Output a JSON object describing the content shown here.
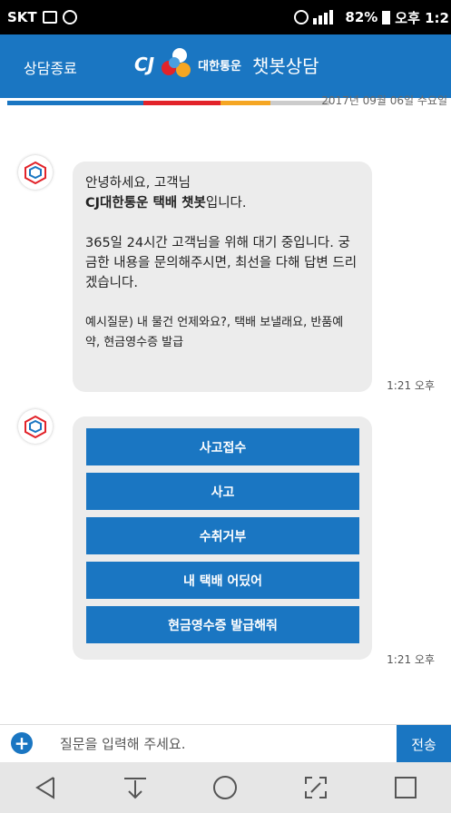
{
  "status_bar": {
    "carrier": "SKT",
    "clock_icon": "alarm-icon",
    "battery": "82%",
    "time": "오후 1:2"
  },
  "header": {
    "end_label": "상담종료",
    "logo_text": "CJ",
    "corp_name": "대한통운",
    "title": "챗봇상담",
    "colors": {
      "bar": "#1a76c2"
    }
  },
  "date": "2017년 09월 06일 수요일",
  "messages": [
    {
      "greeting": "안녕하세요, 고객님",
      "intro_bold": "CJ대한통운 택배 챗봇",
      "intro_rest": "입니다.",
      "para1": "365일 24시간 고객님을 위해 대기 중입니다. 궁금한 내용을 문의해주시면, 최선을 다해 답변 드리겠습니다.",
      "para2": "예시질문) 내 물건 언제와요?, 택배 보낼래요, 반품예약, 현금영수증 발급",
      "time": "1:21 오후"
    },
    {
      "buttons": [
        "사고접수",
        "사고",
        "수취거부",
        "내 택배 어딨어",
        "현금영수증 발급해줘"
      ],
      "time": "1:21 오후"
    }
  ],
  "input": {
    "placeholder": "질문을 입력해 주세요.",
    "send_label": "전송"
  },
  "nav": [
    "back-icon",
    "download-icon",
    "home-icon",
    "screen-expand-icon",
    "recent-apps-icon"
  ]
}
